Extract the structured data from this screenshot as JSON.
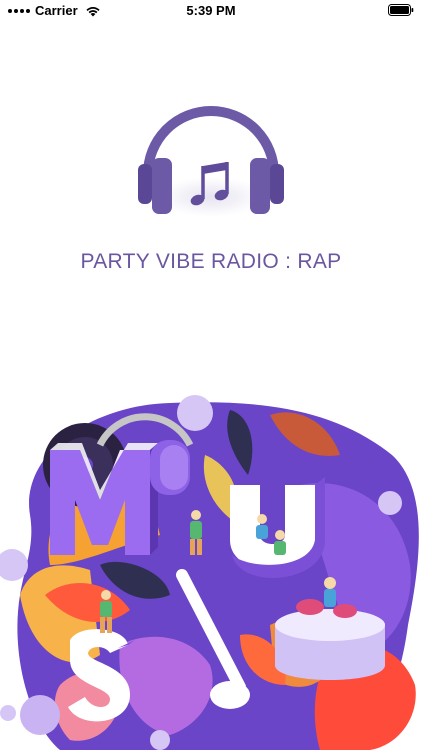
{
  "status_bar": {
    "carrier": "Carrier",
    "time": "5:39 PM",
    "icons": [
      "signal-icon",
      "wifi-icon",
      "battery-icon"
    ]
  },
  "app": {
    "title": "PARTY VIBE RADIO : RAP",
    "logo_icon": "headphones-music-icon",
    "accent_color": "#6b56a0"
  },
  "illustration": {
    "letters": [
      "M",
      "U",
      "S"
    ],
    "theme": "music-festival-icon",
    "colors": {
      "purple": "#7b4fd6",
      "light_purple": "#c9b3f2",
      "orange": "#f39a2a",
      "red": "#e9473c",
      "dark": "#3b2f5c"
    }
  }
}
